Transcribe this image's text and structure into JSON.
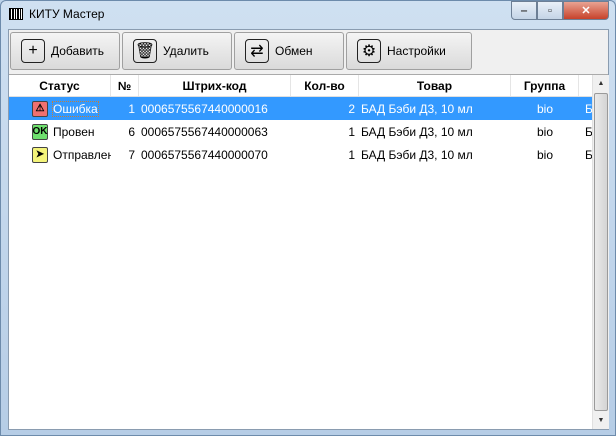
{
  "window": {
    "title": "КИТУ Мастер",
    "min": "‒",
    "max": "▫",
    "close": "✕"
  },
  "toolbar": [
    {
      "label": "Добавить",
      "icon": "+"
    },
    {
      "label": "Удалить",
      "icon": "🗑"
    },
    {
      "label": "Обмен",
      "icon": "⇄"
    },
    {
      "label": "Настройки",
      "icon": "⚙"
    }
  ],
  "table": {
    "columns": [
      "Статус",
      "№",
      "Штрих-код",
      "Кол-во",
      "Товар",
      "Группа",
      ""
    ],
    "rows": [
      {
        "status": "Ошибка",
        "icon": "⚠",
        "color": "#f07070",
        "num": "1",
        "barcode": "0006575567440000016",
        "qty": "2",
        "product": "БАД Бэби Д3, 10 мл",
        "group": "bio",
        "extra": "Б",
        "selected": true
      },
      {
        "status": "Провен",
        "icon": "OK",
        "color": "#6ee06e",
        "num": "6",
        "barcode": "0006575567440000063",
        "qty": "1",
        "product": "БАД Бэби Д3, 10 мл",
        "group": "bio",
        "extra": "Б"
      },
      {
        "status": "Отправлен",
        "icon": "➤",
        "color": "#f4f47a",
        "num": "7",
        "barcode": "0006575567440000070",
        "qty": "1",
        "product": "БАД Бэби Д3, 10 мл",
        "group": "bio",
        "extra": "Б"
      }
    ]
  },
  "scroll": {
    "up": "▲",
    "down": "▼"
  }
}
